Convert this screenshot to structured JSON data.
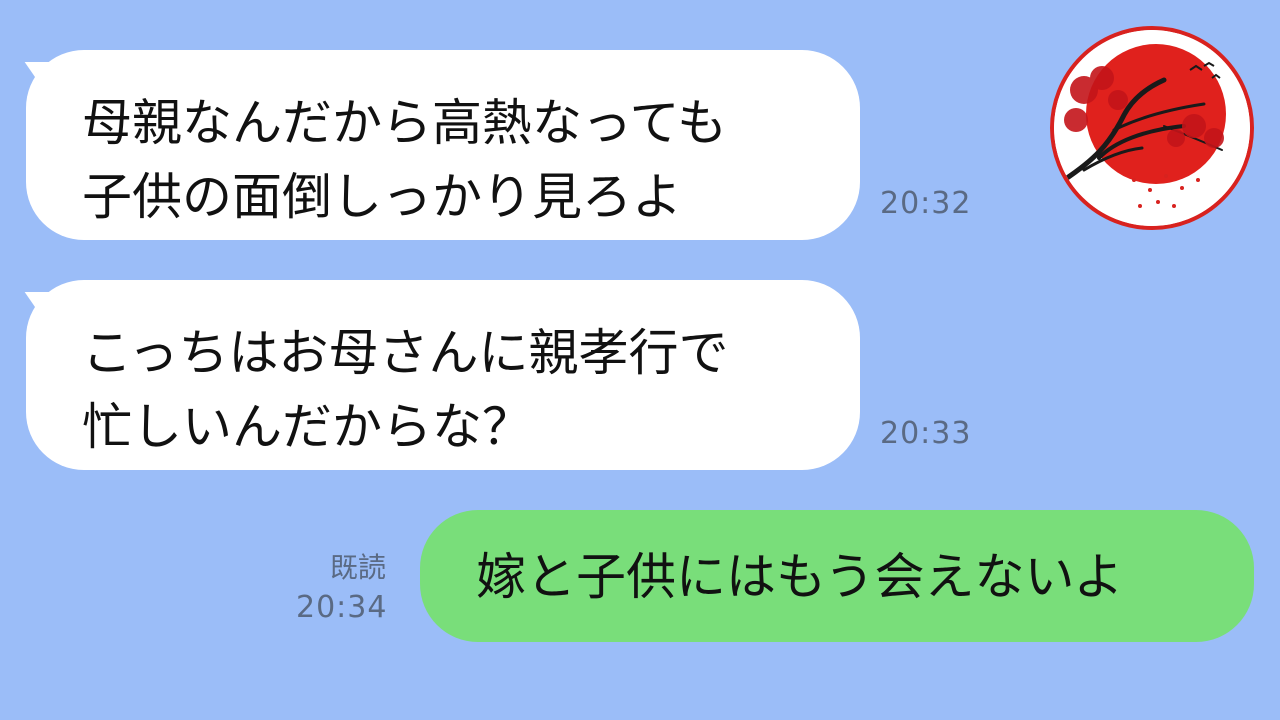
{
  "contact": {
    "avatar_icon": "red-sun-maple-tree-icon",
    "accent": "#d8221f"
  },
  "messages": [
    {
      "side": "incoming",
      "lines": [
        "母親なんだから高熱なっても",
        "子供の面倒しっかり見ろよ"
      ],
      "time": "20:32"
    },
    {
      "side": "incoming",
      "lines": [
        "こっちはお母さんに親孝行で",
        "忙しいんだからな？"
      ],
      "time": "20:33"
    },
    {
      "side": "outgoing",
      "lines": [
        "嫁と子供にはもう会えないよ"
      ],
      "read": "既読",
      "time": "20:34"
    }
  ],
  "colors": {
    "background": "#9bbdf8",
    "incoming_bubble": "#ffffff",
    "outgoing_bubble": "#79de7a",
    "meta_text": "#5a6a84"
  }
}
